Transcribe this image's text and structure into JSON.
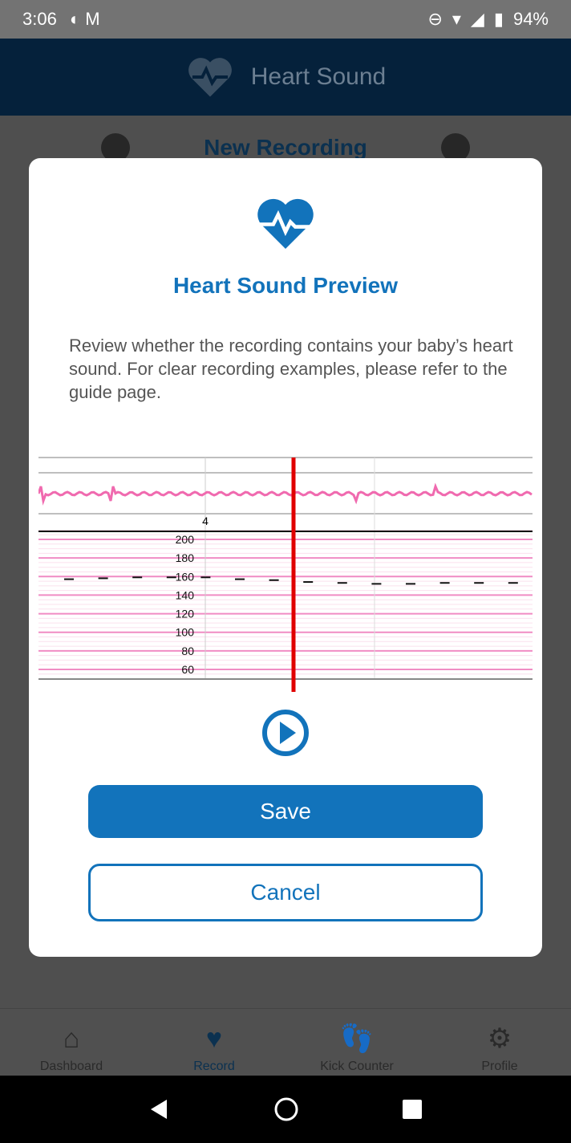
{
  "status": {
    "time": "3:06",
    "battery": "94%"
  },
  "appbar": {
    "title": "Heart Sound"
  },
  "subheader": {
    "title": "New Recording"
  },
  "modal": {
    "title": "Heart Sound Preview",
    "description": "Review whether the recording contains your baby’s heart sound. For clear recording examples, please refer to the guide page.",
    "save_label": "Save",
    "cancel_label": "Cancel"
  },
  "chart_data": {
    "type": "scatter",
    "x_tick_labels": [
      "4"
    ],
    "y_ticks": [
      200,
      180,
      160,
      140,
      120,
      100,
      80,
      60
    ],
    "ylim": [
      50,
      210
    ],
    "heart_rate": [
      158,
      159,
      160,
      160,
      160,
      158,
      157,
      155,
      154,
      153,
      153,
      154,
      154,
      154
    ],
    "waveform_color": "#f06aaf",
    "cursor_color": "#e00000",
    "grid": true
  },
  "bottom_nav": {
    "items": [
      {
        "label": "Dashboard"
      },
      {
        "label": "Record"
      },
      {
        "label": "Kick Counter"
      },
      {
        "label": "Profile"
      }
    ]
  },
  "colors": {
    "accent": "#1273bb",
    "appbar": "#05213b"
  }
}
